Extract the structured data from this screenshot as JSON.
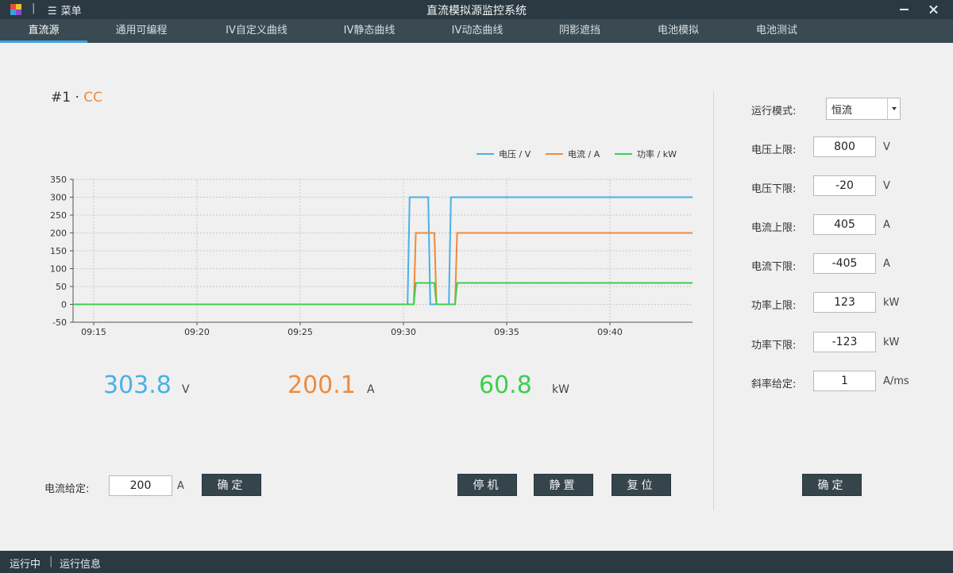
{
  "titlebar": {
    "title": "直流模拟源监控系统",
    "separator": "|",
    "menu_icon": "☰",
    "menu_label": "菜单",
    "logo_icon": "app-logo-icon"
  },
  "tabs": [
    {
      "label": "直流源",
      "active": true
    },
    {
      "label": "通用可编程",
      "active": false
    },
    {
      "label": "IV自定义曲线",
      "active": false
    },
    {
      "label": "IV静态曲线",
      "active": false
    },
    {
      "label": "IV动态曲线",
      "active": false
    },
    {
      "label": "阴影遮挡",
      "active": false
    },
    {
      "label": "电池模拟",
      "active": false
    },
    {
      "label": "电池测试",
      "active": false
    }
  ],
  "channel": {
    "id": "#1",
    "separator": "·",
    "mode": "CC"
  },
  "chart_data": {
    "type": "line",
    "title": "",
    "xlabel": "",
    "ylabel": "",
    "x_ticks": [
      "09:15",
      "09:20",
      "09:25",
      "09:30",
      "09:35",
      "09:40"
    ],
    "y_ticks": [
      -50,
      0,
      50,
      100,
      150,
      200,
      250,
      300,
      350
    ],
    "ylim": [
      -50,
      350
    ],
    "xlim": [
      "09:14",
      "09:44"
    ],
    "grid": true,
    "legend_position": "top-right",
    "series": [
      {
        "name": "电压 / V",
        "color": "#4ab0e6",
        "points": [
          [
            "09:14",
            0
          ],
          [
            "09:30.2",
            0
          ],
          [
            "09:30.3",
            300
          ],
          [
            "09:31.2",
            300
          ],
          [
            "09:31.3",
            0
          ],
          [
            "09:32.2",
            0
          ],
          [
            "09:32.3",
            300
          ],
          [
            "09:44",
            300
          ]
        ]
      },
      {
        "name": "电流 / A",
        "color": "#f08a3a",
        "points": [
          [
            "09:14",
            0
          ],
          [
            "09:30.5",
            0
          ],
          [
            "09:30.6",
            200
          ],
          [
            "09:31.5",
            200
          ],
          [
            "09:31.6",
            0
          ],
          [
            "09:32.5",
            0
          ],
          [
            "09:32.6",
            200
          ],
          [
            "09:44",
            200
          ]
        ]
      },
      {
        "name": "功率 / kW",
        "color": "#3ccf4e",
        "points": [
          [
            "09:14",
            0
          ],
          [
            "09:30.5",
            0
          ],
          [
            "09:30.6",
            60
          ],
          [
            "09:31.5",
            60
          ],
          [
            "09:31.6",
            0
          ],
          [
            "09:32.5",
            0
          ],
          [
            "09:32.6",
            60
          ],
          [
            "09:44",
            60
          ]
        ]
      }
    ]
  },
  "readouts": {
    "voltage": {
      "value": "303.8",
      "unit": "V",
      "color": "#4ab0e6"
    },
    "current": {
      "value": "200.1",
      "unit": "A",
      "color": "#f08a3a"
    },
    "power": {
      "value": "60.8",
      "unit": "kW",
      "color": "#3ccf4e"
    }
  },
  "current_setpoint": {
    "label": "电流给定:",
    "value": "200",
    "unit": "A",
    "confirm": "确定"
  },
  "actions": {
    "stop": "停机",
    "idle": "静置",
    "reset": "复位"
  },
  "settings": {
    "mode_label": "运行模式:",
    "mode_value": "恒流",
    "fields": [
      {
        "label": "电压上限:",
        "value": "800",
        "unit": "V"
      },
      {
        "label": "电压下限:",
        "value": "-20",
        "unit": "V"
      },
      {
        "label": "电流上限:",
        "value": "405",
        "unit": "A"
      },
      {
        "label": "电流下限:",
        "value": "-405",
        "unit": "A"
      },
      {
        "label": "功率上限:",
        "value": "123",
        "unit": "kW"
      },
      {
        "label": "功率下限:",
        "value": "-123",
        "unit": "kW"
      },
      {
        "label": "斜率给定:",
        "value": "1",
        "unit": "A/ms"
      }
    ],
    "confirm": "确定"
  },
  "statusbar": {
    "state": "运行中",
    "separator": "|",
    "info": "运行信息"
  }
}
